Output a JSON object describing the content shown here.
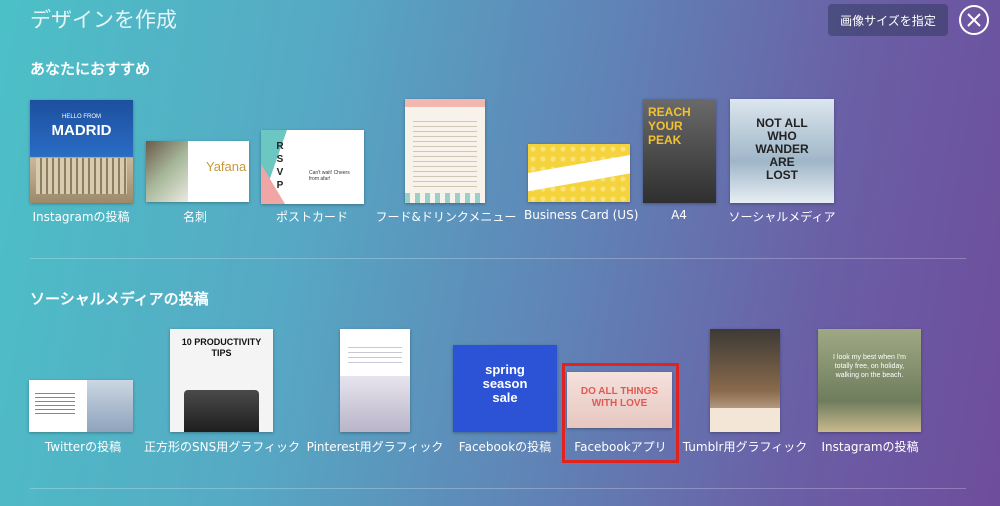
{
  "header": {
    "title": "デザインを作成",
    "size_button": "画像サイズを指定"
  },
  "sections": [
    {
      "heading": "あなたにおすすめ",
      "items": [
        {
          "label": "Instagramの投稿"
        },
        {
          "label": "名刺"
        },
        {
          "label": "ポストカード"
        },
        {
          "label": "フード&ドリンクメニュー"
        },
        {
          "label": "Business Card (US)"
        },
        {
          "label": "A4"
        },
        {
          "label": "ソーシャルメディア"
        }
      ]
    },
    {
      "heading": "ソーシャルメディアの投稿",
      "items": [
        {
          "label": "Twitterの投稿"
        },
        {
          "label": "正方形のSNS用グラフィック"
        },
        {
          "label": "Pinterest用グラフィック"
        },
        {
          "label": "Facebookの投稿"
        },
        {
          "label": "Facebookアプリ"
        },
        {
          "label": "Tumblr用グラフィック"
        },
        {
          "label": "Instagramの投稿"
        }
      ]
    }
  ],
  "thumb_text": {
    "madrid_small": "HELLO FROM",
    "madrid": "MADRID",
    "yafana": "Yafana",
    "rsvp": "R S V P",
    "rsvp_note": "Can't wait! Cheers from afar!",
    "reach": "REACH YOUR PEAK",
    "wander": "NOT ALL WHO WANDER ARE LOST",
    "productivity": "10 PRODUCTIVITY TIPS",
    "spring": "spring season sale",
    "doall": "DO ALL THINGS WITH LOVE",
    "bestwhen": "I look my best when I'm totally free, on holiday, walking on the beach."
  },
  "colors": {
    "highlight": "#e0231f"
  }
}
